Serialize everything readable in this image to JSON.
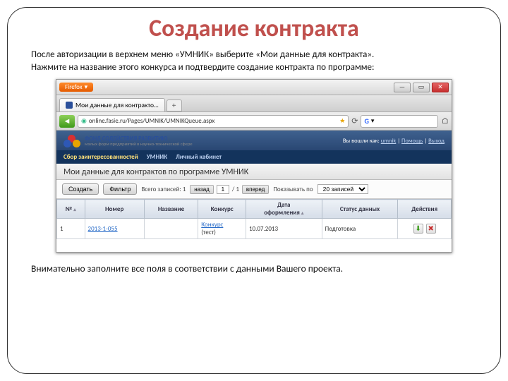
{
  "title": "Создание контракта",
  "intro": {
    "line1": "После авторизации в верхнем меню «УМНИК» выберите «Мои данные для контракта».",
    "line2": "Нажмите на название этого конкурса и подтвердите создание контракта по программе:"
  },
  "outro": "Внимательно заполните все поля в соответствии с данными Вашего проекта.",
  "browser": {
    "firefox": "Firefox",
    "tab": "Мои данные для контракто…",
    "url": "online.fasie.ru/Pages/UMNIK/UMNIKQueue.aspx"
  },
  "app": {
    "brand": {
      "line1": "ФОНД СОДЕЙСТВИЯ РАЗВИТИЮ",
      "line2": "малых форм предприятий в научно-технической сфере"
    },
    "welcome": {
      "prefix": "Вы вошли как:",
      "user": "umnik",
      "help": "Помощь",
      "logout": "Выход"
    },
    "menu": [
      "Сбор заинтересованностей",
      "УМНИК",
      "Личный кабинет"
    ],
    "pagetitle": "Мои данные для контрактов по программе УМНИК",
    "toolbar": {
      "create": "Создать",
      "filter": "Фильтр",
      "total_label": "Всего записей:",
      "total": "1",
      "prev": "назад",
      "page": "1",
      "of": "/ 1",
      "next": "вперед",
      "show_by": "Показывать по",
      "pagesize": "20 записей"
    },
    "grid": {
      "cols": [
        "№",
        "Номер",
        "Название",
        "Конкурс",
        "Дата",
        "Статус данных",
        "Действия"
      ],
      "cols.4a": "Дата",
      "cols.4b": "оформления",
      "rows": [
        {
          "no": "1",
          "number": "2013-1-055",
          "name": "",
          "contest_a": "Конкурс",
          "contest_b": "(тест)",
          "date": "10.07.2013",
          "status": "Подготовка"
        }
      ]
    }
  }
}
